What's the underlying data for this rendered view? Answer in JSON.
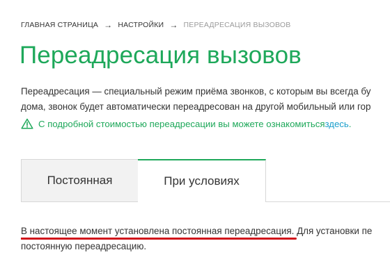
{
  "breadcrumb": {
    "home": "ГЛАВНАЯ СТРАНИЦА",
    "arrow": "→",
    "settings": "НАСТРОЙКИ",
    "current": "ПЕРЕАДРЕСАЦИЯ ВЫЗОВОВ"
  },
  "page_title": "Переадресация вызовов",
  "description": {
    "line1": "Переадресация — специальный режим приёма звонков, с которым вы всегда бу",
    "line2": "дома, звонок будет автоматически переадресован на другой мобильный или гор"
  },
  "notice": {
    "icon": "warning-triangle-icon",
    "text": "С подробной стоимостью переадресации вы можете ознакомиться ",
    "link": "здесь",
    "end": "."
  },
  "tabs": [
    {
      "label": "Постоянная",
      "active": false
    },
    {
      "label": "При условиях",
      "active": true
    }
  ],
  "status": {
    "highlighted": "В настоящее момент установлена постоянная переадресация.",
    "rest": " Для установки пе",
    "line2": "постоянную переадресацию."
  },
  "colors": {
    "accent_green": "#1ea85a",
    "link_blue": "#1a9ecb",
    "underline_red": "#d0121b"
  }
}
